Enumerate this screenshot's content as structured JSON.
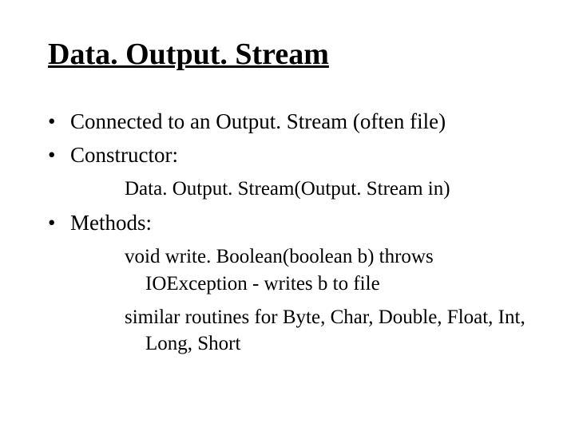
{
  "title": "Data. Output. Stream",
  "bullets": {
    "b1": "Connected to an Output. Stream (often file)",
    "b2": "Constructor:",
    "b2_sub": "Data. Output. Stream(Output. Stream in)",
    "b3": "Methods:",
    "b3_sub1": "void write. Boolean(boolean b) throws IOException - writes b to file",
    "b3_sub2": "similar routines for Byte, Char, Double, Float, Int, Long, Short"
  }
}
